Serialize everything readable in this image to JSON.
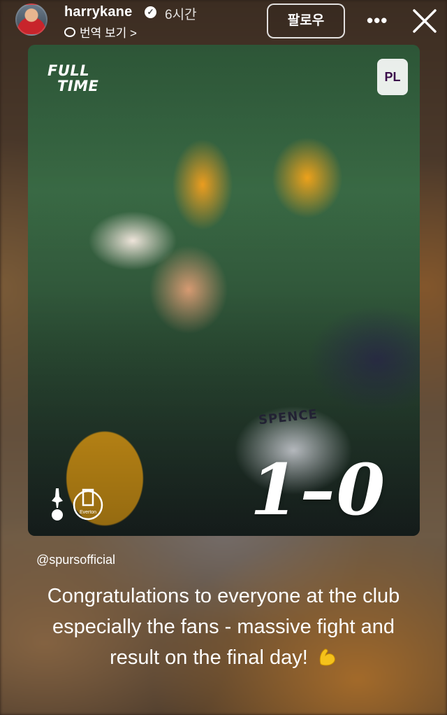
{
  "header": {
    "username": "harrykane",
    "time_ago": "6시간",
    "translate_label": "번역 보기 >",
    "follow_label": "팔로우",
    "more_label": "•••"
  },
  "post_image": {
    "overlay_top": [
      "FULL",
      "TIME"
    ],
    "score": "1–0",
    "jersey_text": "SPENCE",
    "crest_everton_label": "Everton"
  },
  "mention": "@spursofficial",
  "caption": "Congratulations to everyone at the club especially the fans - massive fight and result on the final day!",
  "icons": {
    "verified": "verified-badge-icon",
    "translate": "speech-bubble-icon",
    "close": "close-icon",
    "emoji": "flexed-biceps-emoji"
  },
  "colors": {
    "text": "#ffffff",
    "accent_emoji": "#f5c21b"
  }
}
